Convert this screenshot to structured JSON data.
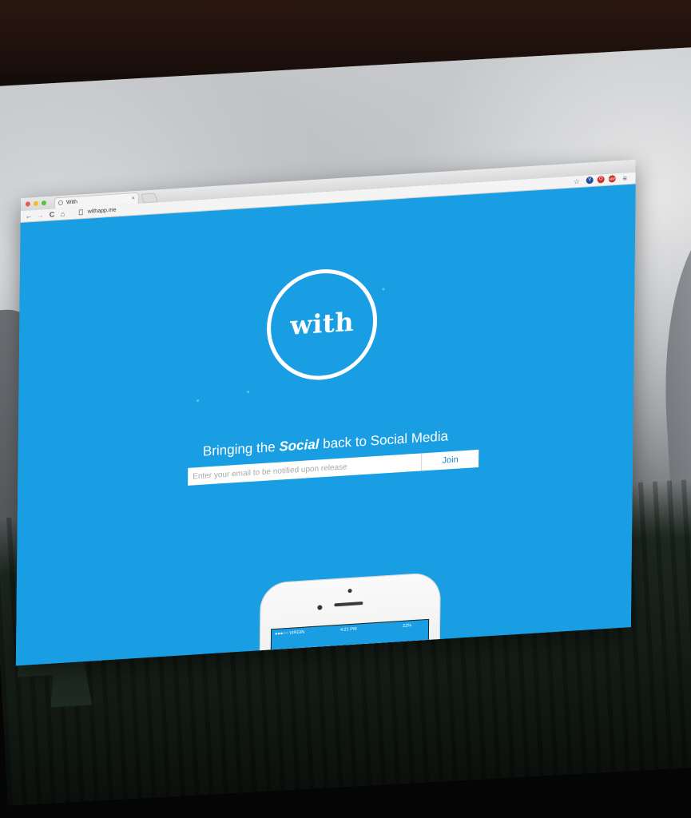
{
  "browser": {
    "tab_title": "With",
    "tab_close": "×",
    "url": "withapp.me",
    "nav": {
      "back": "←",
      "forward": "→",
      "reload": "C",
      "home": "⌂"
    },
    "toolbar_icons": {
      "star": "☆",
      "menu": "≡"
    },
    "extensions": [
      {
        "name": "v-extension-icon",
        "glyph": "V",
        "color": "#1f4fa8"
      },
      {
        "name": "opera-extension-icon",
        "glyph": "O",
        "color": "#d3312a"
      },
      {
        "name": "adblock-extension-icon",
        "glyph": "ABP",
        "color": "#c8362b"
      }
    ],
    "traffic_lights": [
      "#ee5a52",
      "#f1bb2e",
      "#57c23a"
    ]
  },
  "page": {
    "logo_text": "with",
    "tagline_before": "Bringing the ",
    "tagline_emphasis": "Social",
    "tagline_after": " back to Social Media",
    "email_placeholder": "Enter your email to be notified upon release",
    "join_label": "Join",
    "background_color": "#1a9ee3"
  },
  "phone": {
    "carrier": "●●●○○ VIRGIN",
    "time": "4:21 PM",
    "battery": "22%"
  }
}
